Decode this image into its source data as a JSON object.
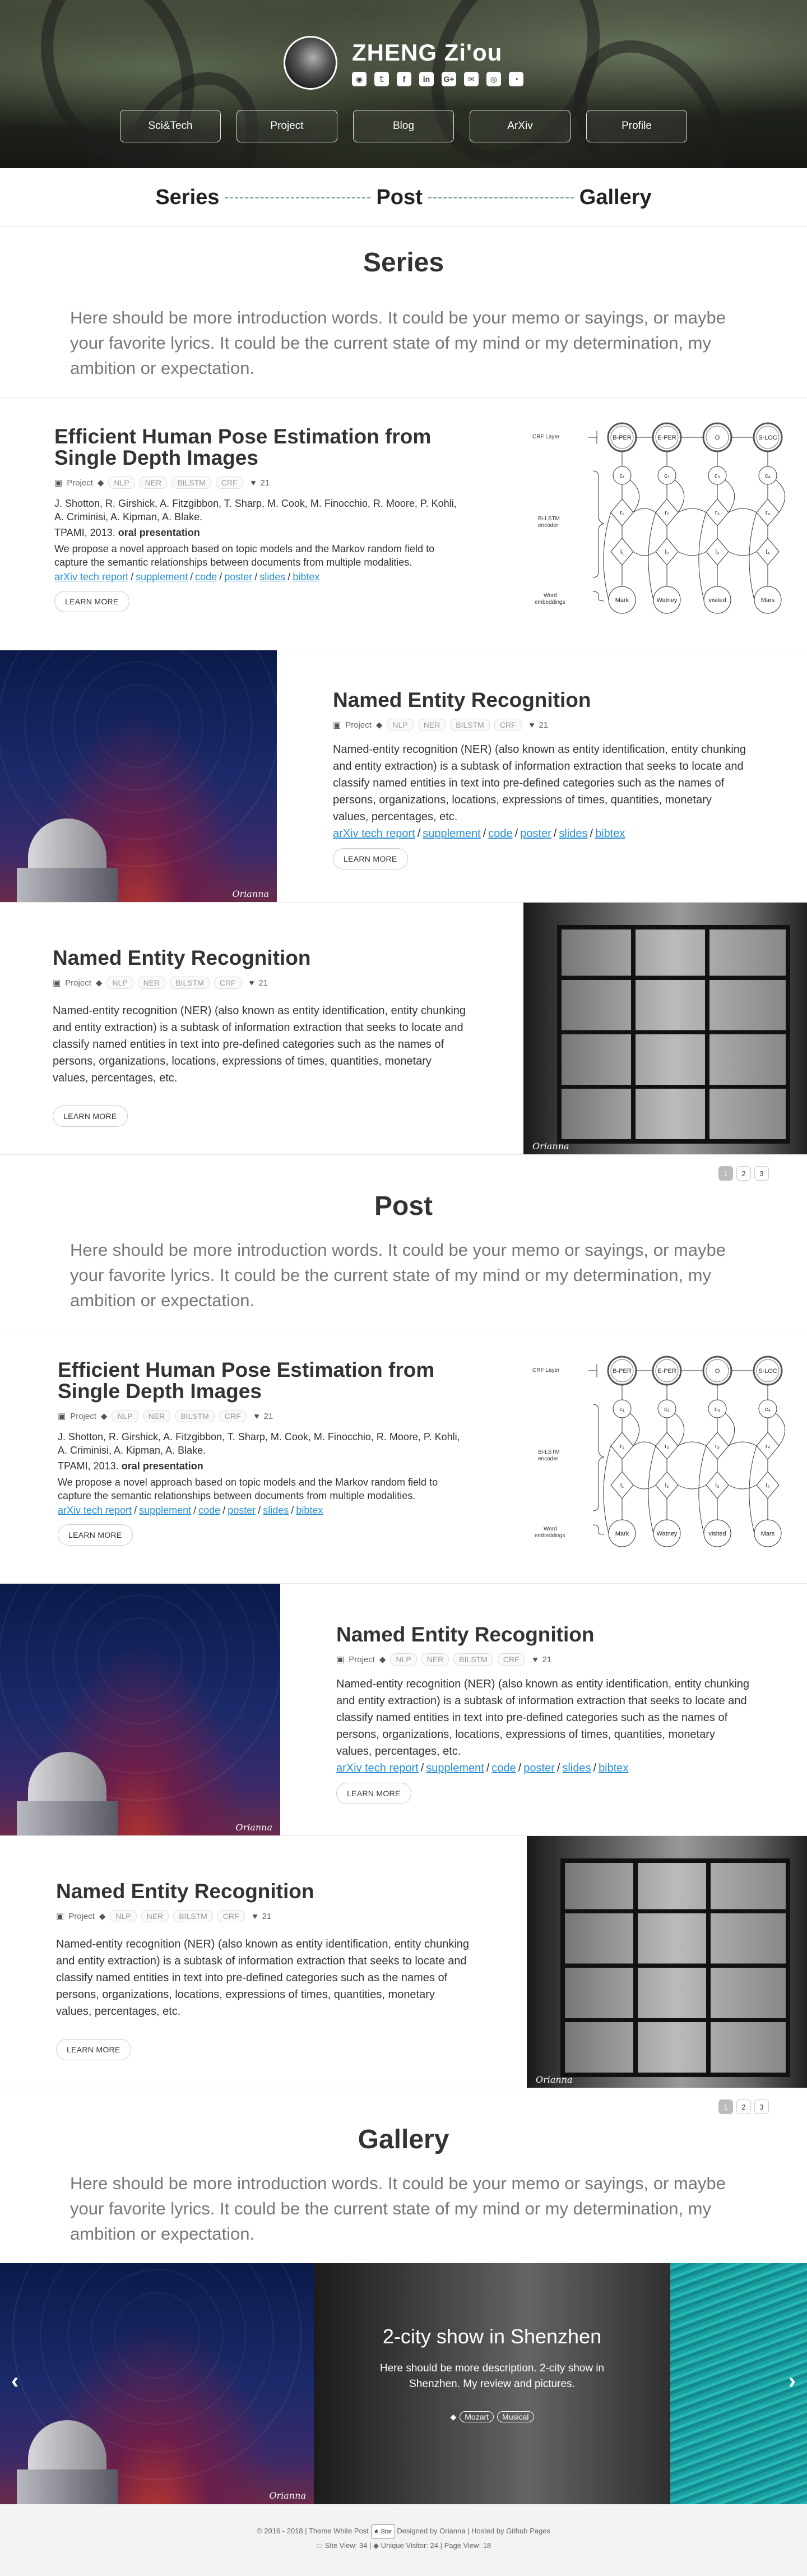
{
  "site": {
    "name": "ZHENG Zi'ou",
    "socials": [
      "github-icon",
      "twitter-icon",
      "facebook-icon",
      "linkedin-icon",
      "googleplus-icon",
      "email-icon",
      "instagram-icon",
      "rss-icon"
    ],
    "social_glyphs": [
      "◉",
      "𝕥",
      "f",
      "in",
      "G+",
      "✉",
      "◎",
      "◔"
    ]
  },
  "nav": [
    "Sci&Tech",
    "Project",
    "Blog",
    "ArXiv",
    "Profile"
  ],
  "section_nav": [
    "Series",
    "Post",
    "Gallery"
  ],
  "intro": "Here should be more introduction words. It could be your memo or sayings, or maybe your favorite lyrics. It could be the current state of my mind or my determination, my ambition or expectation.",
  "sections": {
    "series_title": "Series",
    "post_title": "Post",
    "gallery_title": "Gallery"
  },
  "paper": {
    "title": "Efficient Human Pose Estimation from Single Depth Images",
    "category": "Project",
    "tags": [
      "NLP",
      "NER",
      "BILSTM",
      "CRF"
    ],
    "likes": "21",
    "authors": "J. Shotton, R. Girshick, A. Fitzgibbon, T. Sharp, M. Cook, M. Finocchio, R. Moore, P. Kohli, A. Criminisi, A. Kipman, A. Blake.",
    "venue": "TPAMI, 2013.",
    "venue_note": "oral presentation",
    "abstract": "We propose a novel approach based on topic models and the Markov random field to capture the semantic relationships between documents from multiple modalities.",
    "links": [
      "arXiv tech report",
      "supplement",
      "code",
      "poster",
      "slides",
      "bibtex"
    ],
    "learn_more": "LEARN MORE"
  },
  "ner": {
    "title": "Named Entity Recognition",
    "category": "Project",
    "tags": [
      "NLP",
      "NER",
      "BILSTM",
      "CRF"
    ],
    "likes": "21",
    "desc": "Named-entity recognition (NER) (also known as entity identification, entity chunking and entity extraction) is a subtask of information extraction that seeks to locate and classify named entities in text into pre-defined categories such as the names of persons, organizations, locations, expressions of times, quantities, monetary values, percentages, etc.",
    "desc_alt": "Named-entity recognition (NER) (also known as entity identification, entity chunking and entity extraction) is a subtask of information extraction that seeks to locate and classify named entities in text into pre-defined categories such as the names of persons, organizations, locations, expressions of times, quantities, monetary values, percentages, etc.",
    "links": [
      "arXiv tech report",
      "supplement",
      "code",
      "poster",
      "slides",
      "bibtex"
    ],
    "learn_more": "LEARN MORE"
  },
  "diagram": {
    "crf_layer": "CRF Layer",
    "bilstm": "Bi-LSTM encoder",
    "word_emb": "Word embeddings",
    "labels": [
      "B-PER",
      "E-PER",
      "O",
      "S-LOC"
    ],
    "c_labels": [
      "c₁",
      "c₂",
      "c₃",
      "c₄"
    ],
    "r_labels": [
      "r₁",
      "r₂",
      "r₃",
      "r₄"
    ],
    "l_labels": [
      "l₁",
      "l₂",
      "l₃",
      "l₄"
    ],
    "words": [
      "Mark",
      "Watney",
      "visited",
      "Mars"
    ]
  },
  "photo_credit": "Orianna",
  "pager": [
    "1",
    "2",
    "3"
  ],
  "gallery": {
    "caption_title": "2-city show in Shenzhen",
    "caption_desc": "Here should be more description. 2-city show in Shenzhen. My review and pictures.",
    "tags": [
      "Mozart",
      "Musical"
    ],
    "prev": "‹",
    "next": "›"
  },
  "footer": {
    "copyright": "© 2016 - 2018 | Theme White Post",
    "star": "Star",
    "designed": "Designed by Orianna | Hosted by Github Pages",
    "site_view": "Site View: 34",
    "unique_visitor": "Unique Visitor: 24",
    "page_view": "Page View: 18"
  }
}
